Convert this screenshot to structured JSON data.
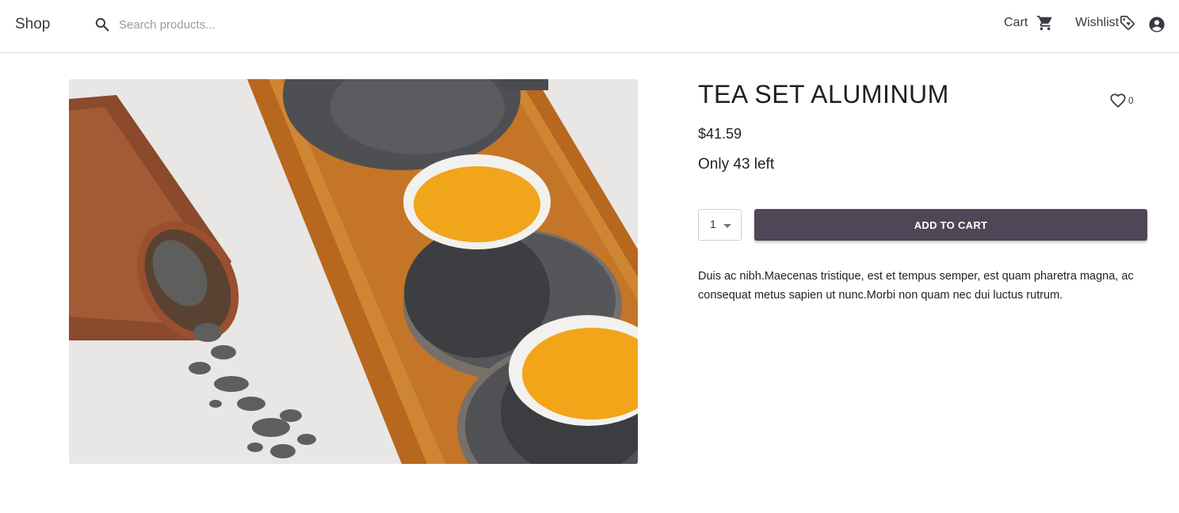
{
  "header": {
    "logo": "Shop",
    "search": {
      "placeholder": "Search products...",
      "value": "",
      "icon": "search-icon"
    },
    "nav": {
      "cart_label": "Cart",
      "cart_icon": "cart-icon",
      "wishlist_label": "Wishlist",
      "wishlist_icon": "tag-icon",
      "account_icon": "account-circle-icon"
    }
  },
  "product": {
    "title": "TEA SET ALUMINUM",
    "price": "$41.59",
    "stock": "Only 43 left",
    "wishlist_count": "0",
    "quantity": "1",
    "add_to_cart_label": "ADD TO CART",
    "description": "Duis ac nibh.Maecenas tristique, est et tempus semper, est quam pharetra magna, ac consequat metus sapien ut nunc.Morbi non quam nec dui luctus rutrum.",
    "image": "tea set photo: teapot, two cups of tea on a wooden tray, bamboo tube with loose tea leaves"
  },
  "colors": {
    "accent": "#4f4657",
    "text": "#231f20",
    "nav_text": "#3d3842",
    "border": "#d9d9d9"
  }
}
